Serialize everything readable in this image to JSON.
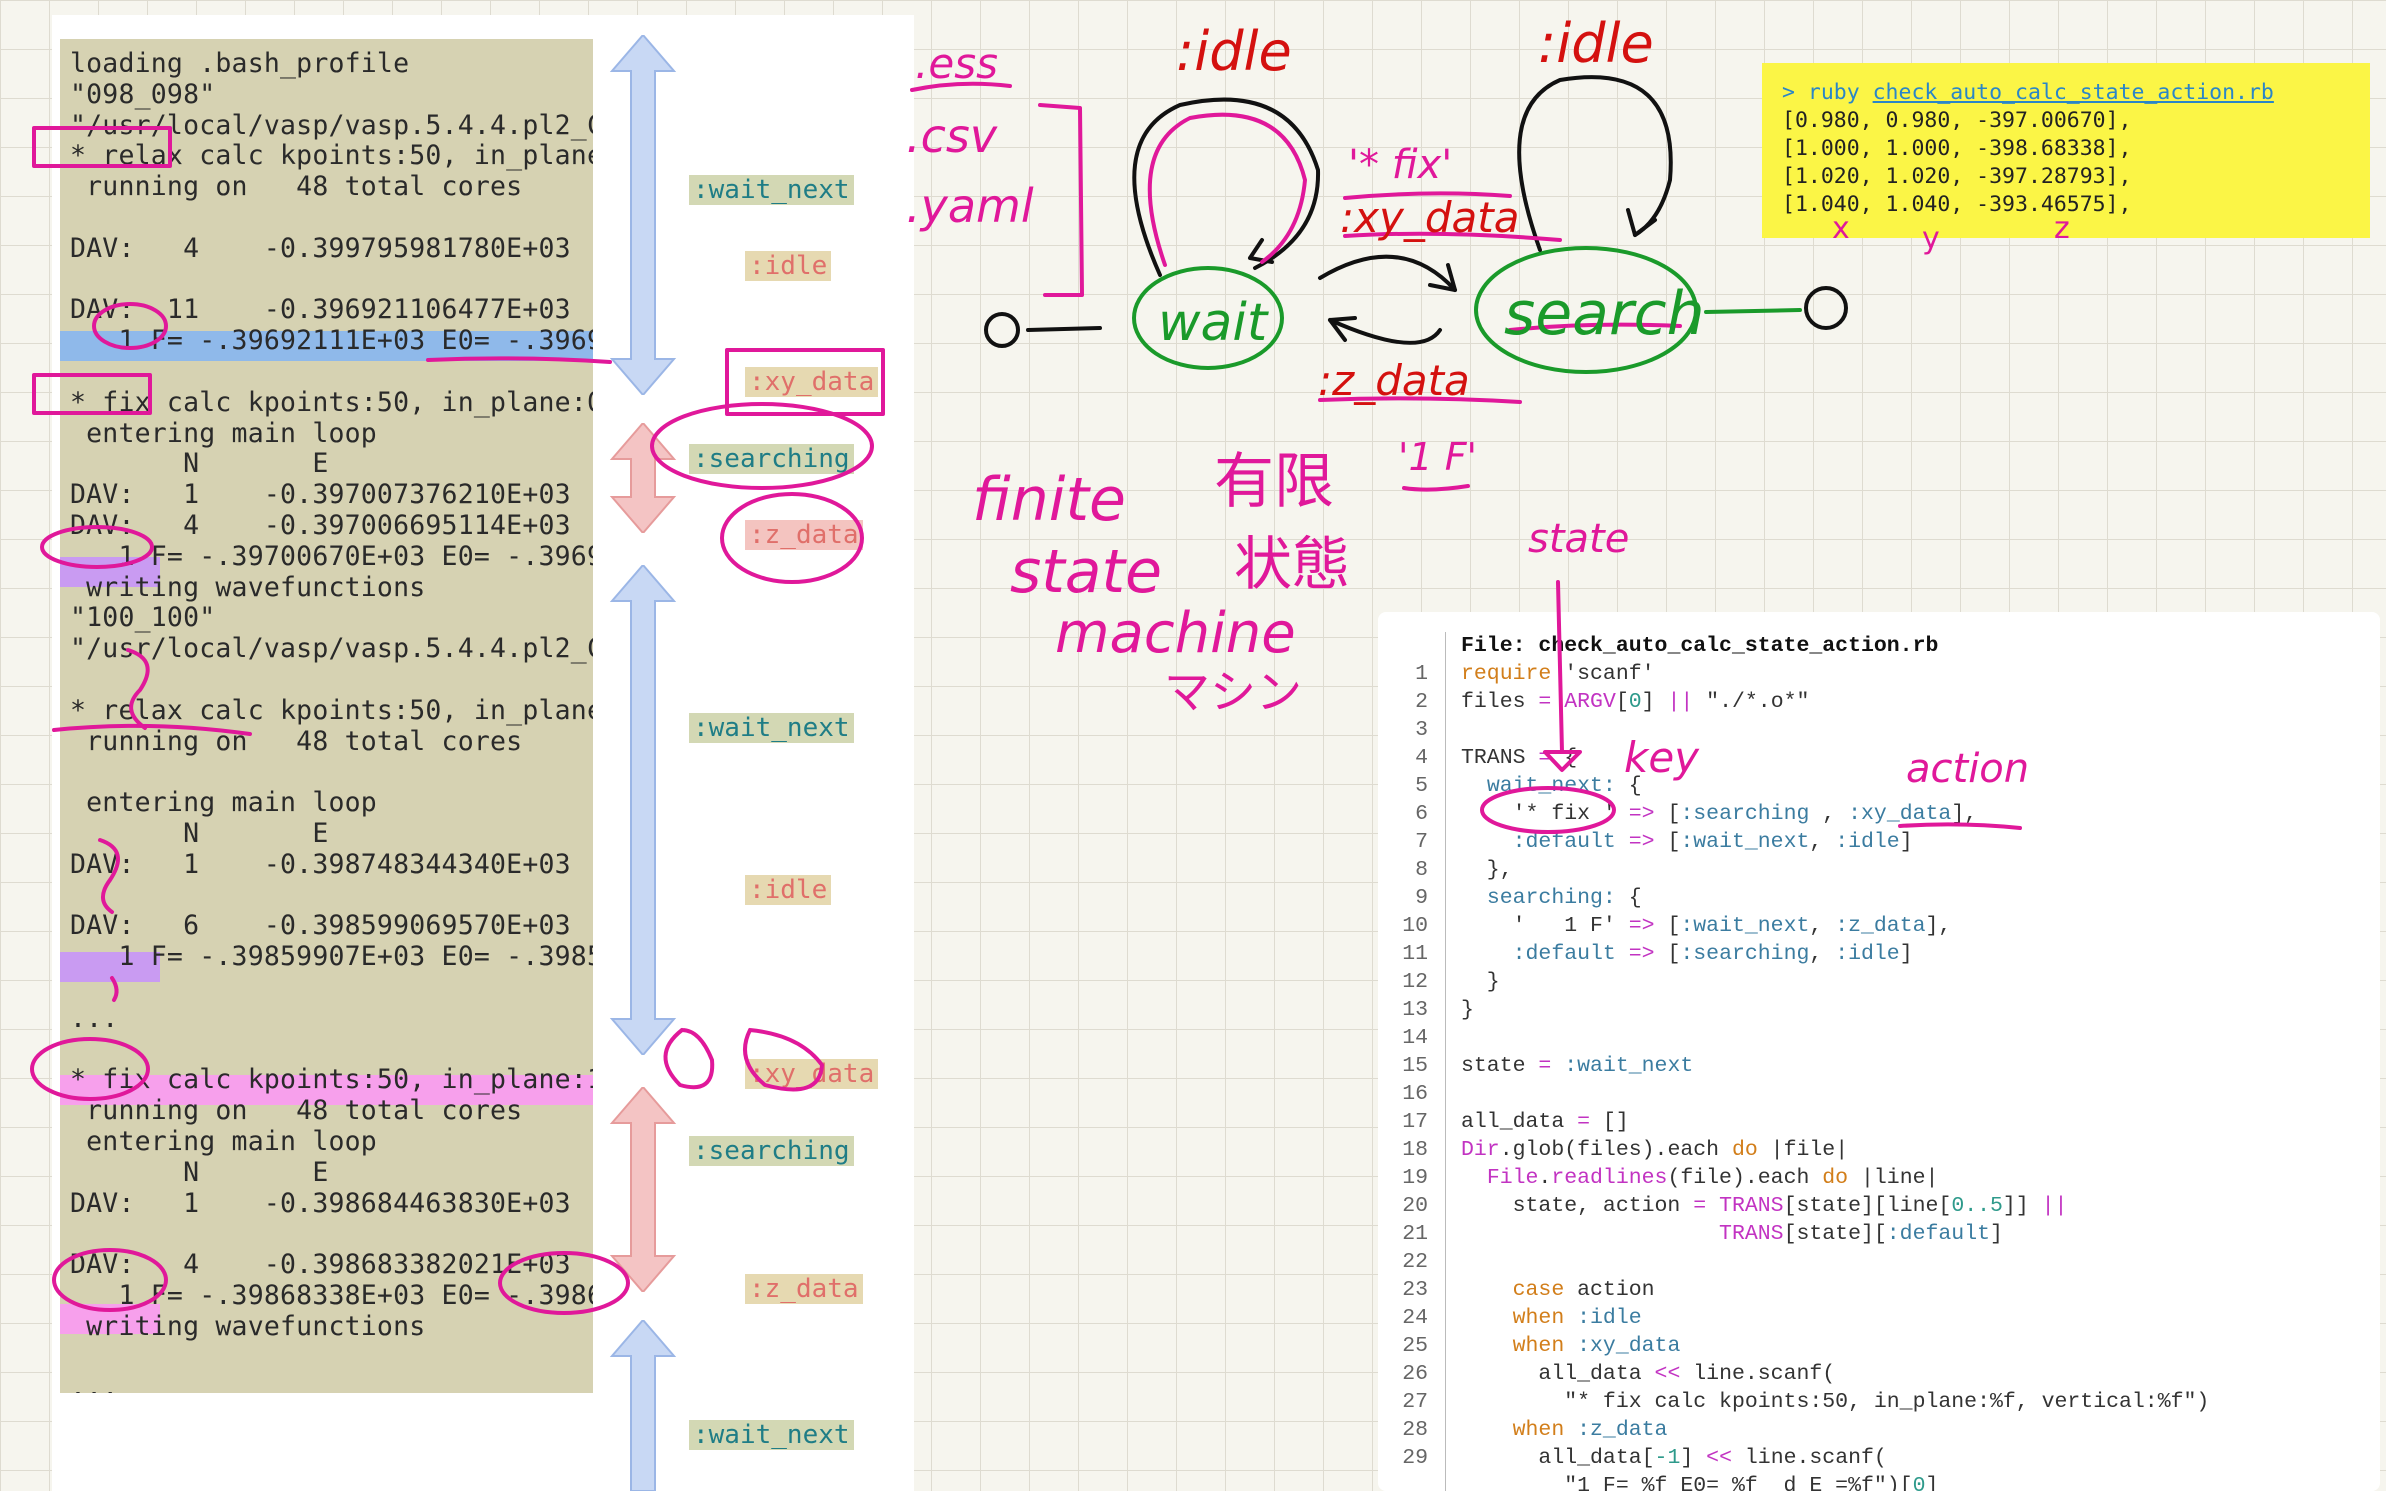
{
  "log": {
    "lines": [
      "loading .bash_profile",
      "\"098_098\"",
      "\"/usr/local/vasp/vasp.5.4.4.pl2_C",
      "* relax calc kpoints:50, in_plane",
      " running on   48 total cores",
      "",
      "DAV:   4    -0.399795981780E+03",
      "",
      "DAV:  11    -0.396921106477E+03",
      "   1 F= -.39692111E+03 E0= -.3969",
      "",
      "* fix calc kpoints:50, in_plane:0",
      " entering main loop",
      "       N       E",
      "DAV:   1    -0.397007376210E+03",
      "DAV:   4    -0.397006695114E+03",
      "   1 F= -.39700670E+03 E0= -.3969",
      " writing wavefunctions",
      "\"100_100\"",
      "\"/usr/local/vasp/vasp.5.4.4.pl2_C",
      "",
      "* relax calc kpoints:50, in_plane",
      " running on   48 total cores",
      "",
      " entering main loop",
      "       N       E",
      "DAV:   1    -0.398748344340E+03",
      "",
      "DAV:   6    -0.398599069570E+03",
      "   1 F= -.39859907E+03 E0= -.3985",
      "",
      "...",
      "",
      "* fix calc kpoints:50, in_plane:1",
      " running on   48 total cores",
      " entering main loop",
      "       N       E",
      "DAV:   1    -0.398684463830E+03",
      "",
      "DAV:   4    -0.398683382021E+03",
      "   1 F= -.39868338E+03 E0= -.3986",
      " writing wavefunctions",
      "",
      "..."
    ]
  },
  "state_tags": {
    "t1": ":wait_next",
    "t2": ":idle",
    "t3": ":xy_data",
    "t4": ":searching",
    "t5": ":z_data",
    "t6": ":wait_next",
    "t7": ":idle",
    "t8": ":xy_data",
    "t9": ":searching",
    "t10": ":z_data",
    "t11": ":wait_next"
  },
  "terminal": {
    "prompt": "> ruby ",
    "command": "check_auto_calc_state_action.rb",
    "rows": [
      "[0.980, 0.980, -397.00670],",
      "[1.000, 1.000, -398.68338],",
      "[1.020, 1.020, -397.28793],",
      "[1.040, 1.040, -393.46575],"
    ]
  },
  "code": {
    "file_label": "File: ",
    "file_name": "check_auto_calc_state_action.rb",
    "line_numbers": [
      "1",
      "2",
      "3",
      "4",
      "5",
      "6",
      "7",
      "8",
      "9",
      "10",
      "11",
      "12",
      "13",
      "14",
      "15",
      "16",
      "17",
      "18",
      "19",
      "20",
      "21",
      "22",
      "23",
      "24",
      "25",
      "26",
      "27",
      "28",
      "29"
    ]
  },
  "annotations": {
    "fsm_idle_left": ":idle",
    "fsm_idle_right": ":idle",
    "fsm_fix": "'* fix'",
    "fsm_xy_data": ":xy_data",
    "fsm_z_data": ":z_data",
    "fsm_1f": "'1 F'",
    "fsm_wait": "wait",
    "fsm_search": "search",
    "ext_ess": ".ess",
    "ext_csv": ".csv",
    "ext_yaml": ".yaml",
    "finite": "finite",
    "state": "state",
    "machine": "machine",
    "jp_finite": "有限",
    "jp_state": "状態",
    "jp_machine": "マシン",
    "code_state": "state",
    "code_key": "key",
    "code_action": "action",
    "xyz_x": "x",
    "xyz_y": "y",
    "xyz_z": "z",
    "q1": "?",
    "q2": "?"
  },
  "colors": {
    "ink_pink": "#e0189a",
    "ink_red": "#d4110f",
    "ink_green": "#1a9a2a",
    "ink_black": "#111111",
    "arrow_blue": "#c4d6f2",
    "arrow_pink": "#f3c0c0"
  }
}
